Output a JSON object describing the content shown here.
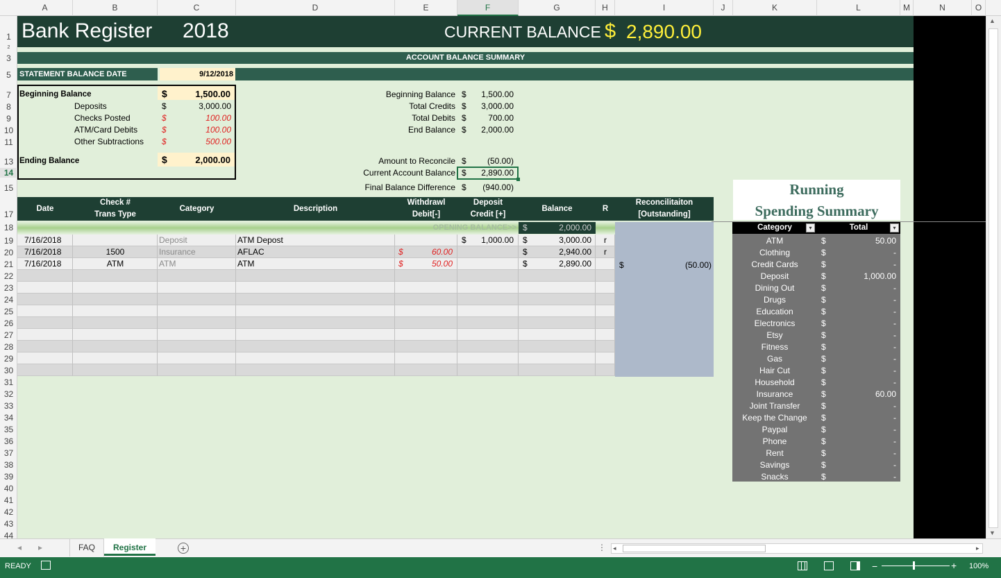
{
  "columns": [
    "A",
    "B",
    "C",
    "D",
    "E",
    "F",
    "G",
    "H",
    "I",
    "J",
    "K",
    "L",
    "M",
    "N",
    "O"
  ],
  "rows": [
    "1",
    "2",
    "3",
    "5",
    "7",
    "8",
    "9",
    "10",
    "11",
    "13",
    "14",
    "15",
    "17",
    "18",
    "19",
    "20",
    "21",
    "22",
    "23",
    "24",
    "25",
    "26",
    "27",
    "28",
    "29",
    "30",
    "31",
    "32",
    "33",
    "34",
    "35",
    "36",
    "37",
    "38",
    "39",
    "40",
    "41",
    "42",
    "43",
    "44"
  ],
  "header": {
    "title": "Bank Register",
    "year": "2018",
    "balance_label": "CURRENT BALANCE",
    "currency": "$",
    "balance_value": "2,890.00"
  },
  "summary_band": "ACCOUNT BALANCE SUMMARY",
  "statement": {
    "label": "STATEMENT BALANCE DATE",
    "date": "9/12/2018"
  },
  "left_box": {
    "beginning_label": "Beginning Balance",
    "beginning_value": "1,500.00",
    "lines": [
      {
        "label": "Deposits",
        "value": "3,000.00",
        "red": false
      },
      {
        "label": "Checks Posted",
        "value": "100.00",
        "red": true
      },
      {
        "label": "ATM/Card Debits",
        "value": "100.00",
        "red": true
      },
      {
        "label": "Other Subtractions",
        "value": "500.00",
        "red": true
      }
    ],
    "ending_label": "Ending Balance",
    "ending_value": "2,000.00"
  },
  "right_summary": [
    {
      "label": "Beginning Balance",
      "value": "1,500.00"
    },
    {
      "label": "Total Credits",
      "value": "3,000.00"
    },
    {
      "label": "Total Debits",
      "value": "700.00"
    },
    {
      "label": "End Balance",
      "value": "2,000.00"
    },
    {
      "label": "Amount to Reconcile",
      "value": "(50.00)"
    },
    {
      "label": "Current Account Balance",
      "value": "2,890.00"
    },
    {
      "label": "Final Balance Difference",
      "value": "(940.00)"
    }
  ],
  "table_headers": {
    "date": "Date",
    "check_1": "Check #",
    "check_2": "Trans Type",
    "category": "Category",
    "description": "Description",
    "withdrawl_1": "Withdrawl",
    "withdrawl_2": "Debit[-]",
    "deposit_1": "Deposit",
    "deposit_2": "Credit [+]",
    "balance": "Balance",
    "r": "R",
    "recon_1": "Reconcilitaiton",
    "recon_2": "[Outstanding]"
  },
  "opening": {
    "label": "OPENING BALANCE>>",
    "value": "2,000.00"
  },
  "transactions": [
    {
      "date": "7/16/2018",
      "check": "",
      "category": "Deposit",
      "description": "ATM Depost",
      "withdrawl": "",
      "deposit": "1,000.00",
      "balance": "3,000.00",
      "r": "r",
      "recon": ""
    },
    {
      "date": "7/16/2018",
      "check": "1500",
      "category": "Insurance",
      "description": "AFLAC",
      "withdrawl": "60.00",
      "deposit": "",
      "balance": "2,940.00",
      "r": "r",
      "recon": ""
    },
    {
      "date": "7/16/2018",
      "check": "ATM",
      "category": "ATM",
      "description": "ATM",
      "withdrawl": "50.00",
      "deposit": "",
      "balance": "2,890.00",
      "r": "",
      "recon": "(50.00)"
    }
  ],
  "spending": {
    "title_1": "Running",
    "title_2": "Spending Summary",
    "col_category": "Category",
    "col_total": "Total",
    "items": [
      {
        "category": "ATM",
        "total": "50.00"
      },
      {
        "category": "Clothing",
        "total": "-"
      },
      {
        "category": "Credit Cards",
        "total": "-"
      },
      {
        "category": "Deposit",
        "total": "1,000.00"
      },
      {
        "category": "Dining Out",
        "total": "-"
      },
      {
        "category": "Drugs",
        "total": "-"
      },
      {
        "category": "Education",
        "total": "-"
      },
      {
        "category": "Electronics",
        "total": "-"
      },
      {
        "category": "Etsy",
        "total": "-"
      },
      {
        "category": "Fitness",
        "total": "-"
      },
      {
        "category": "Gas",
        "total": "-"
      },
      {
        "category": "Hair Cut",
        "total": "-"
      },
      {
        "category": "Household",
        "total": "-"
      },
      {
        "category": "Insurance",
        "total": "60.00"
      },
      {
        "category": "Joint Transfer",
        "total": "-"
      },
      {
        "category": "Keep the Change",
        "total": "-"
      },
      {
        "category": "Paypal",
        "total": "-"
      },
      {
        "category": "Phone",
        "total": "-"
      },
      {
        "category": "Rent",
        "total": "-"
      },
      {
        "category": "Savings",
        "total": "-"
      },
      {
        "category": "Snacks",
        "total": "-"
      }
    ]
  },
  "tabs": [
    "FAQ",
    "Register"
  ],
  "status": {
    "ready": "READY",
    "zoom": "100%"
  },
  "colors": {
    "dark_green": "#1e3f33",
    "band_green": "#2e5e4e",
    "excel_green": "#217346",
    "sheet_bg": "#e1efda",
    "balance_yellow": "#ffef3a"
  }
}
